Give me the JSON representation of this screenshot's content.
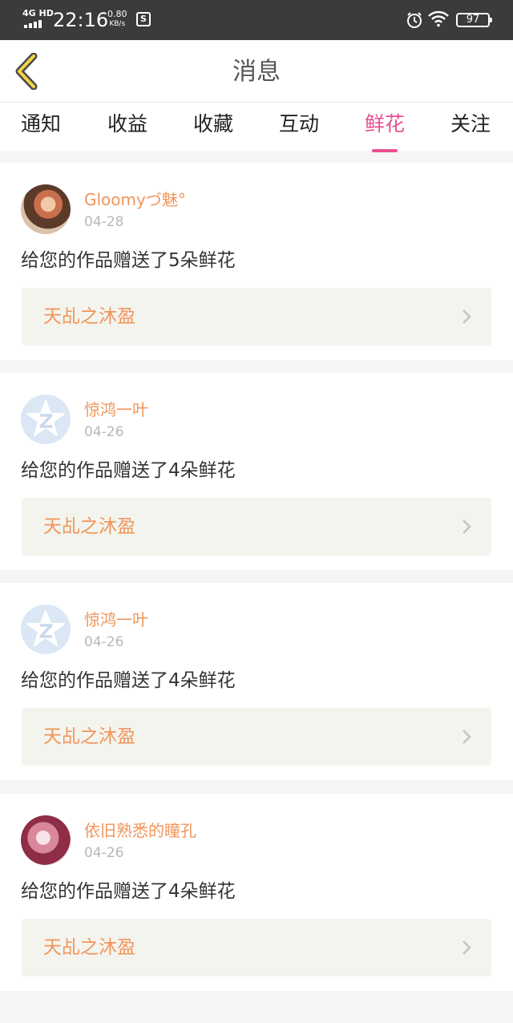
{
  "status_bar": {
    "network": "4G HD",
    "time": "22:16",
    "speed_value": "0.80",
    "speed_unit": "KB/s",
    "battery": "97"
  },
  "header": {
    "title": "消息"
  },
  "tabs": [
    {
      "label": "通知"
    },
    {
      "label": "收益"
    },
    {
      "label": "收藏"
    },
    {
      "label": "互动"
    },
    {
      "label": "鲜花"
    },
    {
      "label": "关注"
    }
  ],
  "active_tab": "鲜花",
  "colors": {
    "accent": "#e94f93",
    "username": "#f0955b",
    "link_bg": "#f4f4ee"
  },
  "notifications": [
    {
      "user": "Gloomyづ魅°",
      "date": "04-28",
      "message": "给您的作品赠送了5朵鲜花",
      "work": "天乩之沐盈",
      "avatar": "user-photo"
    },
    {
      "user": "惊鸿一叶",
      "date": "04-26",
      "message": "给您的作品赠送了4朵鲜花",
      "work": "天乩之沐盈",
      "avatar": "default-qzone-icon"
    },
    {
      "user": "惊鸿一叶",
      "date": "04-26",
      "message": "给您的作品赠送了4朵鲜花",
      "work": "天乩之沐盈",
      "avatar": "default-qzone-icon"
    },
    {
      "user": "依旧熟悉的瞳孔",
      "date": "04-26",
      "message": "给您的作品赠送了4朵鲜花",
      "work": "天乩之沐盈",
      "avatar": "user-photo"
    }
  ]
}
